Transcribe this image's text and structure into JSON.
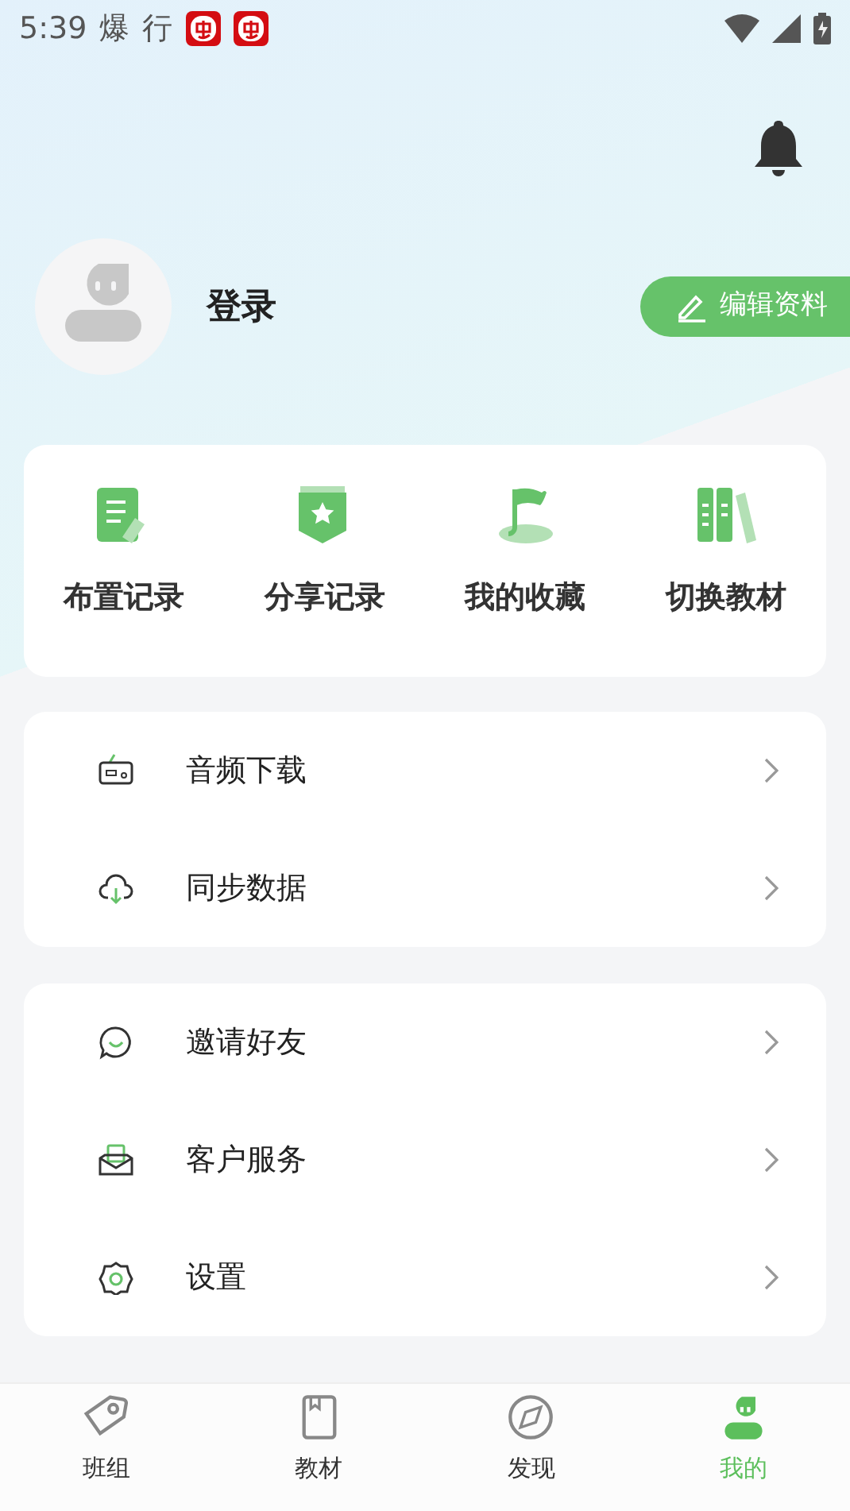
{
  "status_bar": {
    "time": "5:39",
    "notifications": [
      "爆",
      "行"
    ]
  },
  "profile": {
    "name": "登录",
    "edit_button": "编辑资料"
  },
  "shortcuts": [
    {
      "label": "布置记录"
    },
    {
      "label": "分享记录"
    },
    {
      "label": "我的收藏"
    },
    {
      "label": "切换教材"
    }
  ],
  "menu_groups": [
    [
      {
        "label": "音频下载"
      },
      {
        "label": "同步数据"
      }
    ],
    [
      {
        "label": "邀请好友"
      },
      {
        "label": "客户服务"
      },
      {
        "label": "设置"
      }
    ]
  ],
  "tab_bar": [
    {
      "label": "班组",
      "selected": false
    },
    {
      "label": "教材",
      "selected": false
    },
    {
      "label": "发现",
      "selected": false
    },
    {
      "label": "我的",
      "selected": true
    }
  ]
}
